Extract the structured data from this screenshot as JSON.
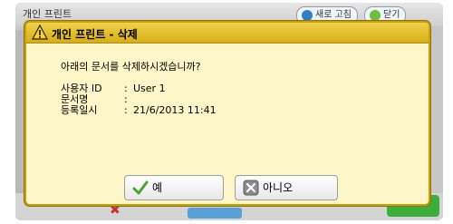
{
  "underlay": {
    "title": "개인 프린트",
    "refresh_label": "새로 고침",
    "close_label": "닫기"
  },
  "dialog": {
    "title": "개인 프린트 - 삭제",
    "question": "아래의 문서를 삭제하시겠습니까?",
    "fields": [
      {
        "label": "사용자 ID",
        "colon": ":",
        "value": "User 1"
      },
      {
        "label": "문서명",
        "colon": ":",
        "value": ""
      },
      {
        "label": "등록일시",
        "colon": ":",
        "value": "21/6/2013 11:41"
      }
    ],
    "yes_label": "예",
    "no_label": "아니오"
  },
  "icons": {
    "warning": "warning-icon",
    "check": "check-icon",
    "cancel": "cancel-icon"
  },
  "colors": {
    "dialog_bg": "#fdf6c8",
    "dialog_header": "#d8ae14",
    "check": "#4aa52e",
    "cancel": "#7a7a7a"
  }
}
